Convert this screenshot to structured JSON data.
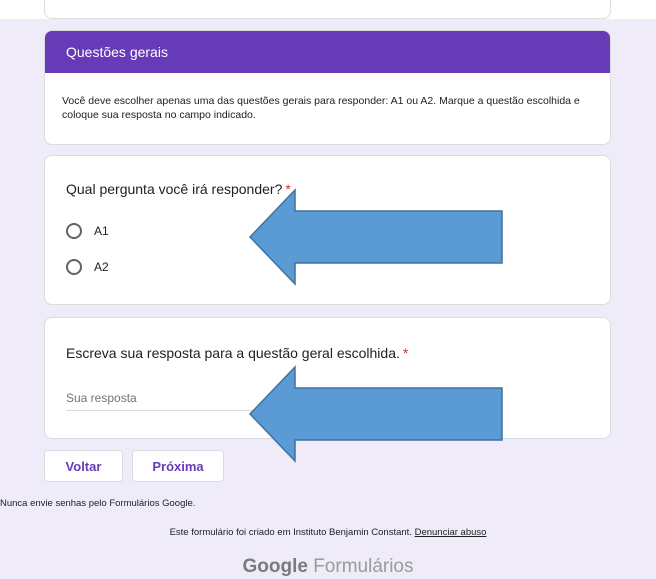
{
  "top_card": {
    "partial_text": ""
  },
  "section": {
    "title": "Questões gerais",
    "description": "Você deve escolher apenas uma das questões gerais para responder: A1 ou A2. Marque a questão escolhida e coloque sua resposta no campo indicado."
  },
  "question1": {
    "title": "Qual pergunta você irá responder?",
    "required_mark": "*",
    "options": [
      {
        "label": "A1",
        "selected": false
      },
      {
        "label": "A2",
        "selected": false
      }
    ]
  },
  "question2": {
    "title": "Escreva sua resposta para a questão geral escolhida.",
    "required_mark": "*",
    "placeholder": "Sua resposta",
    "value": ""
  },
  "buttons": {
    "back": "Voltar",
    "next": "Próxima"
  },
  "footer": {
    "note": "Nunca envie senhas pelo Formulários Google.",
    "created_prefix": "Este formulário foi criado em Instituto Benjamin Constant.",
    "report_link": "Denunciar abuso",
    "brand_google": "Google",
    "brand_forms": "Formulários"
  },
  "colors": {
    "accent": "#673ab7",
    "background": "#efebf8",
    "required": "#d93025",
    "annotation_arrow": "#5b9bd5"
  },
  "annotations": {
    "arrow_icon": "left-arrow-icon"
  }
}
